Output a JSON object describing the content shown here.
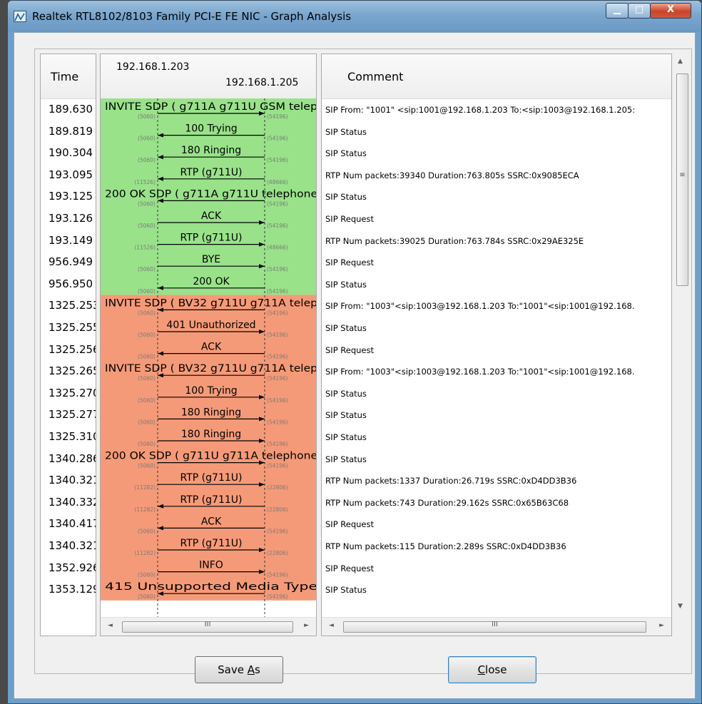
{
  "window": {
    "title": "Realtek RTL8102/8103 Family PCI-E FE NIC - Graph Analysis",
    "minimize_glyph": "▁",
    "maximize_glyph": "□",
    "close_glyph": "X"
  },
  "columns": {
    "time": "Time",
    "host_a": "192.168.1.203",
    "host_b": "192.168.1.205",
    "comment": "Comment"
  },
  "colors": {
    "call1_bg": "#99e28a",
    "call2_bg": "#f59a78"
  },
  "rows": [
    {
      "time": "189.630",
      "label": "INVITE SDP ( g711A g711U GSM telep",
      "dir": "right",
      "lport": "(5060)",
      "rport": "(54196)",
      "group": 1,
      "comment": "SIP From: \"1001\" <sip:1001@192.168.1.203 To:<sip:1003@192.168.1.205:"
    },
    {
      "time": "189.819",
      "label": "100 Trying",
      "dir": "left",
      "lport": "(5060)",
      "rport": "(54196)",
      "group": 1,
      "comment": "SIP Status"
    },
    {
      "time": "190.304",
      "label": "180 Ringing",
      "dir": "left",
      "lport": "(5060)",
      "rport": "(54196)",
      "group": 1,
      "comment": "SIP Status"
    },
    {
      "time": "193.095",
      "label": "RTP (g711U)",
      "dir": "left",
      "lport": "(11526)",
      "rport": "(48666)",
      "group": 1,
      "comment": "RTP Num packets:39340  Duration:763.805s SSRC:0x9085ECA"
    },
    {
      "time": "193.125",
      "label": "200 OK SDP ( g711A g711U telephone",
      "dir": "left",
      "lport": "(5060)",
      "rport": "(54196)",
      "group": 1,
      "comment": "SIP Status"
    },
    {
      "time": "193.126",
      "label": "ACK",
      "dir": "right",
      "lport": "(5060)",
      "rport": "(54196)",
      "group": 1,
      "comment": "SIP Request"
    },
    {
      "time": "193.149",
      "label": "RTP (g711U)",
      "dir": "right",
      "lport": "(11526)",
      "rport": "(48666)",
      "group": 1,
      "comment": "RTP Num packets:39025  Duration:763.784s SSRC:0x29AE325E"
    },
    {
      "time": "956.949",
      "label": "BYE",
      "dir": "right",
      "lport": "(5060)",
      "rport": "(54196)",
      "group": 1,
      "comment": "SIP Request"
    },
    {
      "time": "956.950",
      "label": "200 OK",
      "dir": "left",
      "lport": "(5060)",
      "rport": "(54196)",
      "group": 1,
      "comment": "SIP Status"
    },
    {
      "time": "1325.253",
      "label": "INVITE SDP ( BV32 g711U g711A telep",
      "dir": "left",
      "lport": "(5060)",
      "rport": "(54196)",
      "group": 2,
      "comment": "SIP From: \"1003\"<sip:1003@192.168.1.203 To:\"1001\"<sip:1001@192.168."
    },
    {
      "time": "1325.255",
      "label": "401 Unauthorized",
      "dir": "right",
      "lport": "(5060)",
      "rport": "(54196)",
      "group": 2,
      "comment": "SIP Status"
    },
    {
      "time": "1325.256",
      "label": "ACK",
      "dir": "left",
      "lport": "(5060)",
      "rport": "(54196)",
      "group": 2,
      "comment": "SIP Request"
    },
    {
      "time": "1325.265",
      "label": "INVITE SDP ( BV32 g711U g711A telep",
      "dir": "left",
      "lport": "(5060)",
      "rport": "(54196)",
      "group": 2,
      "comment": "SIP From: \"1003\"<sip:1003@192.168.1.203 To:\"1001\"<sip:1001@192.168."
    },
    {
      "time": "1325.270",
      "label": "100 Trying",
      "dir": "right",
      "lport": "(5060)",
      "rport": "(54196)",
      "group": 2,
      "comment": "SIP Status"
    },
    {
      "time": "1325.277",
      "label": "180 Ringing",
      "dir": "right",
      "lport": "(5060)",
      "rport": "(54196)",
      "group": 2,
      "comment": "SIP Status"
    },
    {
      "time": "1325.310",
      "label": "180 Ringing",
      "dir": "right",
      "lport": "(5060)",
      "rport": "(54196)",
      "group": 2,
      "comment": "SIP Status"
    },
    {
      "time": "1340.286",
      "label": "200 OK SDP ( g711U g711A telephone",
      "dir": "right",
      "lport": "(5060)",
      "rport": "(54196)",
      "group": 2,
      "comment": "SIP Status"
    },
    {
      "time": "1340.321",
      "label": "RTP (g711U)",
      "dir": "right",
      "lport": "(11282)",
      "rport": "(22806)",
      "group": 2,
      "comment": "RTP Num packets:1337  Duration:26.719s SSRC:0xD4DD3B36"
    },
    {
      "time": "1340.332",
      "label": "RTP (g711U)",
      "dir": "left",
      "lport": "(11282)",
      "rport": "(22806)",
      "group": 2,
      "comment": "RTP Num packets:743  Duration:29.162s SSRC:0x65B63C68"
    },
    {
      "time": "1340.417",
      "label": "ACK",
      "dir": "left",
      "lport": "(5060)",
      "rport": "(54196)",
      "group": 2,
      "comment": "SIP Request"
    },
    {
      "time": "1340.321",
      "label": "RTP (g711U)",
      "dir": "right",
      "lport": "(11282)",
      "rport": "(22806)",
      "group": 2,
      "comment": "RTP Num packets:115  Duration:2.289s SSRC:0xD4DD3B36"
    },
    {
      "time": "1352.926",
      "label": "INFO",
      "dir": "right",
      "lport": "(5060)",
      "rport": "(54196)",
      "group": 2,
      "comment": "SIP Request"
    },
    {
      "time": "1353.129",
      "label": "415 Unsupported Media Type",
      "dir": "left",
      "lport": "(5060)",
      "rport": "(54196)",
      "group": 2,
      "comment": "SIP Status"
    }
  ],
  "scrollbars": {
    "left_arrow": "◄",
    "right_arrow": "►",
    "up_arrow": "▲",
    "down_arrow": "▼",
    "grip": "III",
    "vgrip": "≡"
  },
  "buttons": {
    "save_as_pre": "Save ",
    "save_as_key": "A",
    "save_as_post": "s",
    "close_key": "C",
    "close_post": "lose"
  }
}
